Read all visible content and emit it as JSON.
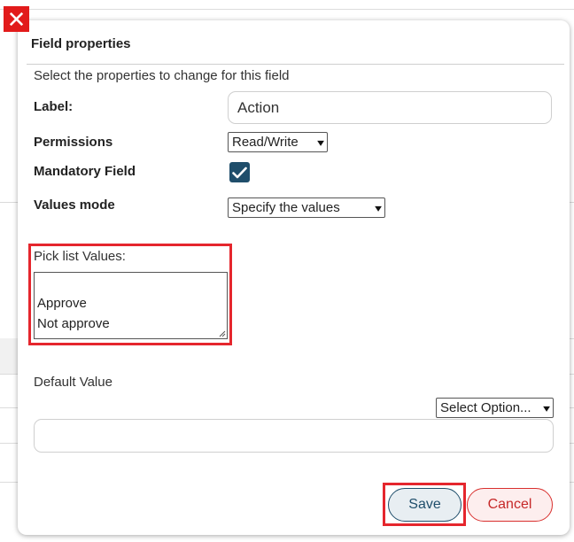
{
  "close": {
    "glyph": "✕"
  },
  "dialog": {
    "title": "Field properties",
    "subtitle": "Select the properties to change for this field"
  },
  "form": {
    "label": {
      "caption": "Label:",
      "value": "Action"
    },
    "permissions": {
      "caption": "Permissions",
      "selected": "Read/Write"
    },
    "mandatory": {
      "caption": "Mandatory Field",
      "checked": true
    },
    "values_mode": {
      "caption": "Values mode",
      "selected": "Specify the values"
    },
    "picklist": {
      "caption": "Pick list Values:",
      "lines": [
        "",
        "Approve",
        "Not approve"
      ]
    },
    "default_value": {
      "caption": "Default Value",
      "select_label": "Select Option...",
      "value": ""
    }
  },
  "actions": {
    "save": "Save",
    "cancel": "Cancel"
  },
  "colors": {
    "close_bg": "#e21b1b",
    "highlight": "#e5262d",
    "checkbox": "#1f4e6b",
    "save_text": "#1f4e6b",
    "cancel_text": "#c62828"
  }
}
